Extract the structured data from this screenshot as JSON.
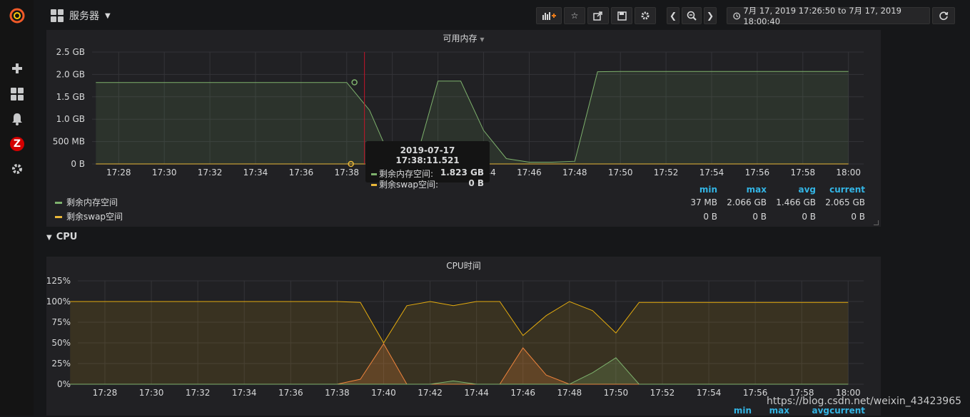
{
  "topbar": {
    "dashboard_title": "服务器",
    "time_range": "7月 17, 2019 17:26:50 to 7月 17, 2019 18:00:40"
  },
  "sidebar": {
    "icons": [
      "grafana-logo-icon",
      "plus-icon",
      "dashboards-icon",
      "bell-icon",
      "zabbix-icon",
      "gear-icon"
    ],
    "zabbix_letter": "Z"
  },
  "memory_panel": {
    "title": "可用内存",
    "y_ticks": [
      "2.5 GB",
      "2.0 GB",
      "1.5 GB",
      "1.0 GB",
      "500 MB",
      "0 B"
    ],
    "x_ticks": [
      "17:28",
      "17:30",
      "17:32",
      "17:34",
      "17:36",
      "17:38",
      "17:40",
      "17:42",
      "17:44",
      "17:46",
      "17:48",
      "17:50",
      "17:52",
      "17:54",
      "17:56",
      "17:58",
      "18:00"
    ],
    "legend_headers": [
      "min",
      "max",
      "avg",
      "current"
    ],
    "legend": [
      {
        "name": "剩余内存空间",
        "color": "#7eb26d",
        "min": "37 MB",
        "max": "2.066 GB",
        "avg": "1.466 GB",
        "current": "2.065 GB"
      },
      {
        "name": "剩余swap空间",
        "color": "#eab839",
        "min": "0 B",
        "max": "0 B",
        "avg": "0 B",
        "current": "0 B"
      }
    ],
    "tooltip": {
      "time": "2019-07-17 17:38:11.521",
      "rows": [
        {
          "name": "剩余内存空间:",
          "value": "1.823 GB",
          "color": "#7eb26d"
        },
        {
          "name": "剩余swap空间:",
          "value": "0 B",
          "color": "#eab839"
        }
      ]
    }
  },
  "cpu_row": {
    "title": "CPU"
  },
  "cpu_panel": {
    "title": "CPU时间",
    "y_ticks": [
      "125%",
      "100%",
      "75%",
      "50%",
      "25%",
      "0%"
    ],
    "x_ticks": [
      "17:28",
      "17:30",
      "17:32",
      "17:34",
      "17:36",
      "17:38",
      "17:40",
      "17:42",
      "17:44",
      "17:46",
      "17:48",
      "17:50",
      "17:52",
      "17:54",
      "17:56",
      "17:58",
      "18:00"
    ],
    "legend_headers": [
      "min",
      "max",
      "avg",
      "current"
    ]
  },
  "watermark": "https://blog.csdn.net/weixin_43423965",
  "chart_data": [
    {
      "type": "area",
      "title": "可用内存",
      "x": [
        "17:27",
        "17:38",
        "17:39",
        "17:40",
        "17:41",
        "17:42",
        "17:43",
        "17:44",
        "17:45",
        "17:46",
        "17:47",
        "17:48",
        "17:49",
        "17:50",
        "18:00"
      ],
      "series": [
        {
          "name": "剩余内存空间",
          "unit": "GB",
          "values": [
            1.82,
            1.82,
            1.2,
            0.03,
            0.03,
            1.85,
            1.85,
            0.75,
            0.12,
            0.04,
            0.04,
            0.06,
            2.06,
            2.066,
            2.065
          ]
        },
        {
          "name": "剩余swap空间",
          "unit": "GB",
          "values": [
            0,
            0,
            0,
            0,
            0,
            0,
            0,
            0,
            0,
            0,
            0,
            0,
            0,
            0,
            0
          ]
        }
      ],
      "ylim": [
        0,
        2.5
      ]
    },
    {
      "type": "area",
      "title": "CPU时间",
      "x": [
        "17:26:30",
        "17:38",
        "17:39",
        "17:40",
        "17:41",
        "17:42",
        "17:43",
        "17:44",
        "17:45",
        "17:46",
        "17:47",
        "17:48",
        "17:49",
        "17:50",
        "17:51",
        "18:00"
      ],
      "series": [
        {
          "values": [
            100,
            100,
            99,
            50,
            95,
            100,
            95,
            100,
            100,
            59,
            83,
            100,
            89,
            62,
            99,
            99
          ]
        },
        {
          "values": [
            0,
            0,
            6,
            49,
            0,
            0,
            0,
            0,
            0,
            44,
            11,
            0,
            0,
            0,
            0,
            0
          ]
        },
        {
          "values": [
            0,
            0,
            0,
            0,
            0,
            0,
            4,
            0,
            0,
            0,
            0,
            0,
            14,
            32,
            0,
            0
          ]
        }
      ],
      "ylim": [
        0,
        125
      ]
    }
  ]
}
